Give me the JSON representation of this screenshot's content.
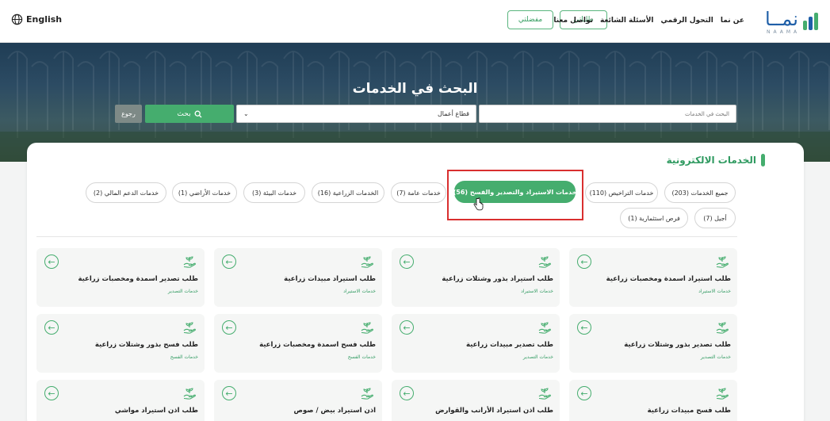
{
  "header": {
    "language": "English",
    "brand": {
      "word": "نمــا",
      "sub": "NAAMA"
    },
    "nav": [
      "عن نما",
      "التحول الرقمي",
      "الأسئلة الشائعة",
      "تواصل معنا"
    ],
    "requests_button": "طلباتي",
    "favorites_button": "مفضلتي"
  },
  "hero": {
    "title": "البحث في الخدمات",
    "search_placeholder": "البحث في الخدمات",
    "sector_value": "قطاع أعمال",
    "search_button": "بحث",
    "back_button": "رجوع"
  },
  "section": {
    "title": "الخدمات الالكترونية"
  },
  "categories": [
    {
      "label": "جميع الخدمات (203)",
      "active": false
    },
    {
      "label": "خدمات التراخيص (110)",
      "active": false
    },
    {
      "label": "خدمات الاستيراد والتصدير والفسح (56)",
      "active": true
    },
    {
      "label": "خدمات عامة (7)",
      "active": false
    },
    {
      "label": "الخدمات الزراعية (16)",
      "active": false
    },
    {
      "label": "خدمات البيئة (3)",
      "active": false
    },
    {
      "label": "خدمات الأراضي (1)",
      "active": false
    },
    {
      "label": "خدمات الدعم المالي (2)",
      "active": false
    },
    {
      "label": "أجيل (7)",
      "active": false
    },
    {
      "label": "فرص استثمارية (1)",
      "active": false
    }
  ],
  "services": [
    {
      "title": "طلب استيراد اسمدة ومخصبات زراعية",
      "category": "خدمات الاستيراد"
    },
    {
      "title": "طلب استيراد بذور وشتلات زراعية",
      "category": "خدمات الاستيراد"
    },
    {
      "title": "طلب استيراد مبيدات زراعية",
      "category": "خدمات الاستيراد"
    },
    {
      "title": "طلب تصدير اسمدة ومخصبات زراعية",
      "category": "خدمات التصدير"
    },
    {
      "title": "طلب تصدير بذور وشتلات زراعية",
      "category": "خدمات التصدير"
    },
    {
      "title": "طلب تصدير مبيدات زراعية",
      "category": "خدمات التصدير"
    },
    {
      "title": "طلب فسح اسمدة ومخصبات زراعية",
      "category": "خدمات الفسح"
    },
    {
      "title": "طلب فسح بذور وشتلات زراعية",
      "category": "خدمات الفسح"
    },
    {
      "title": "طلب فسح مبيدات زراعية",
      "category": ""
    },
    {
      "title": "طلب اذن استيراد الأرانب والقوارض",
      "category": ""
    },
    {
      "title": "اذن استيراد بيض / صوص",
      "category": ""
    },
    {
      "title": "طلب اذن استيراد مواشي",
      "category": ""
    }
  ],
  "colors": {
    "accent": "#45ad6e",
    "highlight": "#d92f2f",
    "brand": "#1f5fa8"
  }
}
